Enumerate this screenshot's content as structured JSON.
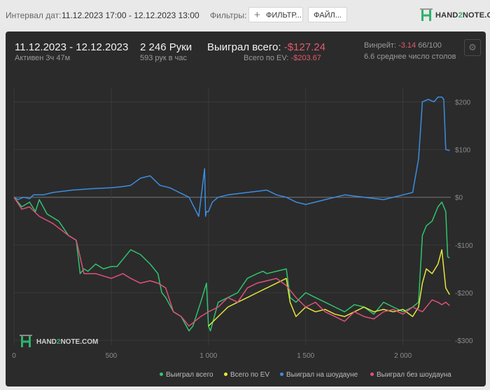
{
  "topbar": {
    "date_label": "Интервал дат:",
    "date_range": "11.12.2023 17:00 - 12.12.2023 13:00",
    "filters_label": "Фильтры:",
    "filter_button": "ФИЛЬТР...",
    "file_button": "ФАЙЛ..."
  },
  "brand": {
    "pre": "HAND",
    "mid": "2",
    "post": "NOTE.COM"
  },
  "summary": {
    "period": "11.12.2023 - 12.12.2023",
    "active": "Активен 3ч 47м",
    "hands": "2 246 Руки",
    "hands_per_hour": "593 рук в час",
    "won_label": "Выиграл всего:",
    "won_value": "-$127.24",
    "ev_label": "Всего по EV:",
    "ev_value": "-$203.67",
    "winrate_label": "Винрейт:",
    "winrate_value": "-3.14",
    "winrate_rest": "66/100",
    "tables": "6.6 среднее число столов"
  },
  "colors": {
    "won": "#2fc46e",
    "ev": "#e6e63c",
    "showdown": "#3d8de0",
    "nonshowdown": "#e0507a",
    "negative": "#e05a6b"
  },
  "chart_data": {
    "type": "line",
    "xlim": [
      0,
      2246
    ],
    "ylim": [
      -310,
      230
    ],
    "x_ticks": [
      "0",
      "500",
      "1 000",
      "1 500",
      "2 000"
    ],
    "x_tick_values": [
      0,
      500,
      1000,
      1500,
      2000
    ],
    "y_ticks": [
      "$200",
      "$100",
      "$0",
      "-$100",
      "-$200",
      "-$300"
    ],
    "y_tick_values": [
      200,
      100,
      0,
      -100,
      -200,
      -300
    ],
    "series": [
      {
        "name": "Выиграл всего",
        "color": "#2fc46e",
        "x": [
          0,
          40,
          80,
          110,
          130,
          170,
          230,
          280,
          320,
          340,
          360,
          380,
          420,
          460,
          500,
          530,
          560,
          600,
          650,
          700,
          740,
          760,
          780,
          820,
          860,
          900,
          920,
          960,
          990,
          1000,
          1010,
          1050,
          1100,
          1150,
          1200,
          1250,
          1280,
          1300,
          1350,
          1400,
          1420,
          1450,
          1500,
          1550,
          1600,
          1650,
          1700,
          1750,
          1800,
          1850,
          1900,
          1950,
          2000,
          2050,
          2080,
          2100,
          2120,
          2150,
          2180,
          2200,
          2220,
          2230,
          2240
        ],
        "y": [
          0,
          -20,
          -10,
          -30,
          -5,
          -35,
          -50,
          -80,
          -90,
          -160,
          -150,
          -155,
          -140,
          -150,
          -145,
          -145,
          -130,
          -110,
          -120,
          -140,
          -160,
          -200,
          -210,
          -240,
          -250,
          -280,
          -270,
          -220,
          -180,
          -270,
          -280,
          -220,
          -210,
          -200,
          -170,
          -160,
          -155,
          -160,
          -155,
          -150,
          -210,
          -220,
          -200,
          -210,
          -220,
          -230,
          -240,
          -225,
          -230,
          -245,
          -220,
          -230,
          -240,
          -230,
          -220,
          -80,
          -60,
          -50,
          -20,
          -10,
          -30,
          -125,
          -127
        ]
      },
      {
        "name": "Всего по EV",
        "color": "#e6e63c",
        "x": [
          1000,
          1050,
          1100,
          1150,
          1200,
          1250,
          1300,
          1350,
          1400,
          1420,
          1450,
          1500,
          1550,
          1600,
          1650,
          1700,
          1750,
          1800,
          1850,
          1900,
          1950,
          2000,
          2050,
          2080,
          2100,
          2120,
          2150,
          2180,
          2200,
          2220,
          2240
        ],
        "y": [
          -270,
          -250,
          -230,
          -220,
          -210,
          -200,
          -190,
          -180,
          -170,
          -220,
          -250,
          -230,
          -240,
          -235,
          -245,
          -250,
          -240,
          -230,
          -240,
          -235,
          -240,
          -235,
          -250,
          -230,
          -180,
          -150,
          -160,
          -140,
          -110,
          -190,
          -204
        ]
      },
      {
        "name": "Выиграл на шоудауне",
        "color": "#3d8de0",
        "x": [
          0,
          20,
          50,
          80,
          100,
          150,
          200,
          300,
          400,
          500,
          550,
          600,
          650,
          700,
          750,
          800,
          850,
          900,
          950,
          980,
          985,
          990,
          1000,
          1020,
          1050,
          1100,
          1200,
          1300,
          1350,
          1400,
          1450,
          1500,
          1550,
          1600,
          1700,
          1800,
          1900,
          2000,
          2050,
          2080,
          2090,
          2100,
          2130,
          2160,
          2180,
          2200,
          2210,
          2220,
          2240
        ],
        "y": [
          0,
          -5,
          0,
          -3,
          5,
          5,
          10,
          15,
          18,
          20,
          22,
          25,
          40,
          45,
          25,
          20,
          10,
          0,
          -40,
          60,
          -40,
          -30,
          -30,
          -10,
          0,
          5,
          10,
          15,
          5,
          0,
          -10,
          -15,
          -10,
          -5,
          5,
          0,
          -5,
          5,
          10,
          80,
          140,
          200,
          205,
          200,
          210,
          210,
          205,
          100,
          98
        ]
      },
      {
        "name": "Выиграл без шоудауна",
        "color": "#e0507a",
        "x": [
          0,
          40,
          80,
          130,
          200,
          280,
          320,
          360,
          420,
          460,
          500,
          560,
          600,
          650,
          700,
          740,
          780,
          820,
          860,
          900,
          960,
          1000,
          1050,
          1100,
          1150,
          1200,
          1250,
          1300,
          1350,
          1400,
          1450,
          1500,
          1550,
          1600,
          1650,
          1700,
          1750,
          1800,
          1850,
          1900,
          1950,
          2000,
          2050,
          2100,
          2150,
          2180,
          2200,
          2220,
          2240
        ],
        "y": [
          0,
          -25,
          -20,
          -40,
          -55,
          -80,
          -90,
          -160,
          -160,
          -165,
          -170,
          -160,
          -170,
          -180,
          -175,
          -180,
          -190,
          -240,
          -250,
          -270,
          -250,
          -240,
          -230,
          -210,
          -220,
          -190,
          -180,
          -175,
          -170,
          -185,
          -210,
          -230,
          -220,
          -240,
          -250,
          -260,
          -240,
          -250,
          -255,
          -240,
          -235,
          -245,
          -230,
          -240,
          -215,
          -220,
          -225,
          -220,
          -227
        ]
      }
    ]
  },
  "legend": [
    {
      "label": "Выиграл всего",
      "color": "#2fc46e"
    },
    {
      "label": "Всего по EV",
      "color": "#e6e63c"
    },
    {
      "label": "Выиграл на шоудауне",
      "color": "#3d8de0"
    },
    {
      "label": "Выиграл без шоудауна",
      "color": "#e0507a"
    }
  ]
}
